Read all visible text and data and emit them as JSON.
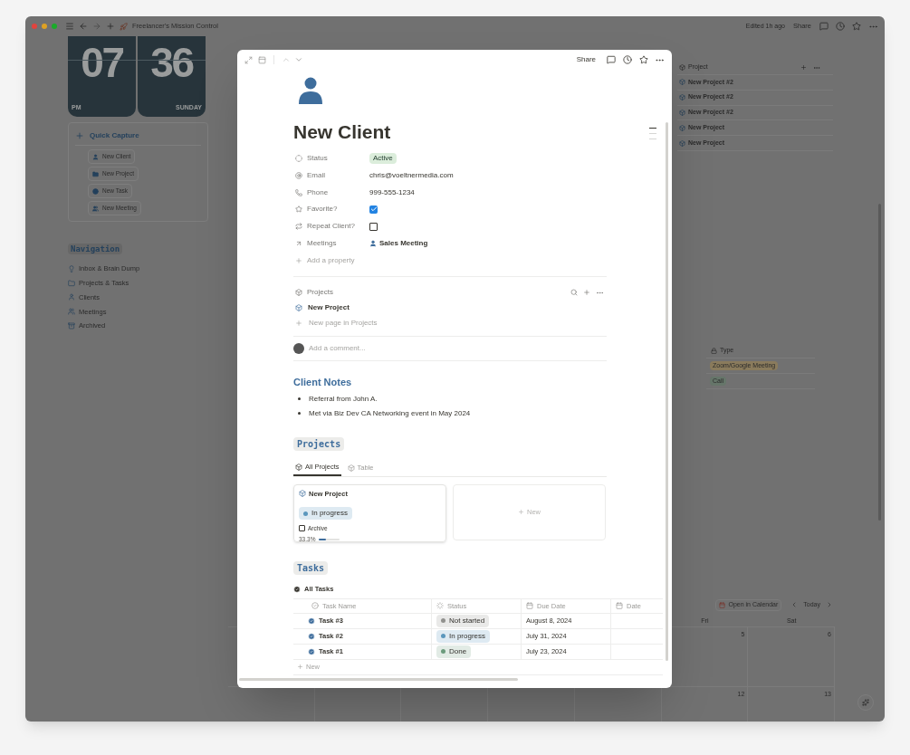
{
  "window": {
    "title": "Freelancer's Mission Control",
    "edited": "Edited 1h ago",
    "share": "Share"
  },
  "clock": {
    "hour": "07",
    "minute": "36",
    "meridiem": "PM",
    "day": "SUNDAY"
  },
  "quick_capture": {
    "title": "Quick Capture",
    "buttons": [
      "New Client",
      "New Project",
      "New Task",
      "New Meeting"
    ]
  },
  "navigation": {
    "title": "Navigation",
    "items": [
      "Inbox & Brain Dump",
      "Projects & Tasks",
      "Clients",
      "Meetings",
      "Archived"
    ]
  },
  "background_projects": {
    "column": "Project",
    "rows": [
      "New Project #2",
      "New Project #2",
      "New Project #2",
      "New Project",
      "New Project"
    ]
  },
  "background_meetings": {
    "column": "Type",
    "rows": [
      {
        "label": "Zoom/Google Meeting",
        "color": "#8a7b5c"
      },
      {
        "label": "Call",
        "color": "#66766a"
      }
    ]
  },
  "calendar": {
    "button": "Open in Calendar",
    "today": "Today",
    "days": [
      "Fri",
      "Sat"
    ],
    "dates": [
      "5",
      "6",
      "12",
      "13"
    ]
  },
  "modal": {
    "share": "Share",
    "title": "New Client",
    "properties": [
      {
        "kind": "status",
        "label": "Status",
        "value": "Active"
      },
      {
        "kind": "text",
        "label": "Email",
        "value": "chris@voeltnermedia.com"
      },
      {
        "kind": "text",
        "label": "Phone",
        "value": "999-555-1234"
      },
      {
        "kind": "checkbox",
        "label": "Favorite?",
        "checked": true
      },
      {
        "kind": "checkbox",
        "label": "Repeat Client?",
        "checked": false
      },
      {
        "kind": "relation",
        "label": "Meetings",
        "value": "Sales Meeting"
      }
    ],
    "add_property": "Add a property",
    "relation": {
      "title": "Projects",
      "items": [
        "New Project"
      ],
      "new_page": "New page in Projects"
    },
    "comment_placeholder": "Add a comment...",
    "notes": {
      "heading": "Client Notes",
      "bullets": [
        "Referral from John A.",
        "Met via Biz Dev CA Networking event in May 2024"
      ]
    },
    "projects": {
      "heading": "Projects",
      "tabs": [
        {
          "label": "All Projects",
          "selected": true
        },
        {
          "label": "Table",
          "selected": false
        }
      ],
      "cards": [
        {
          "title": "New Project",
          "status": "In progress",
          "color": "#5b97bd",
          "archive": "Archive",
          "checked": false,
          "progress": "33.3%",
          "level": 0.333
        }
      ],
      "new": "New"
    },
    "tasks": {
      "heading": "Tasks",
      "view": "All Tasks",
      "columns": [
        "Task Name",
        "Status",
        "Due Date",
        "Date"
      ],
      "rows": [
        {
          "name": "Task #3",
          "status": "Not started",
          "color": "#91918e",
          "due": "August 8, 2024"
        },
        {
          "name": "Task #2",
          "status": "In progress",
          "color": "#5b97bd",
          "due": "July 31, 2024"
        },
        {
          "name": "Task #1",
          "status": "Done",
          "color": "#6c9b7d",
          "due": "July 23, 2024"
        }
      ],
      "new": "New"
    }
  }
}
